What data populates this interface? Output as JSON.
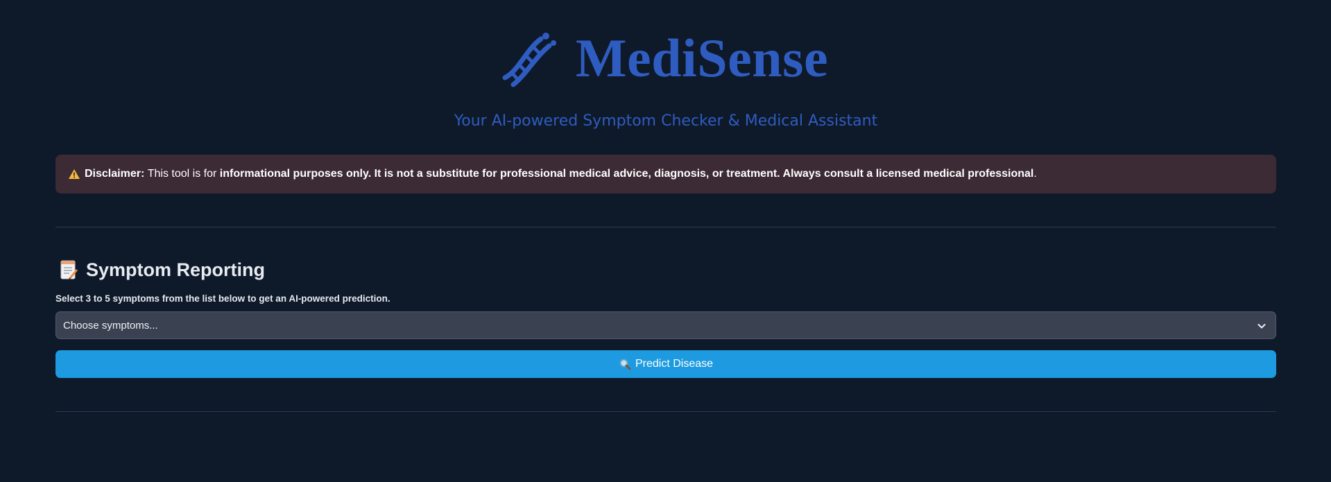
{
  "header": {
    "title": "MediSense",
    "subtitle": "Your AI-powered Symptom Checker & Medical Assistant",
    "logo_icon": "dna-icon"
  },
  "disclaimer": {
    "icon": "warning-icon",
    "label": "Disclaimer:",
    "text_lead": "This tool is for",
    "text_bold": "informational purposes only. It is not a substitute for professional medical advice, diagnosis, or treatment. Always consult a licensed medical professional",
    "text_end": "."
  },
  "symptoms": {
    "heading_icon": "memo-icon",
    "heading": "Symptom Reporting",
    "instruction": "Select 3 to 5 symptoms from the list below to get an AI-powered prediction.",
    "select_placeholder": "Choose symptoms...",
    "predict_icon": "magnifier-icon",
    "predict_label": "Predict Disease"
  },
  "colors": {
    "background": "#0e1a2a",
    "brand": "#2f5cc0",
    "disclaimer_bg": "#3c2a35",
    "button": "#1e9be0",
    "select_bg": "#3a4252"
  }
}
